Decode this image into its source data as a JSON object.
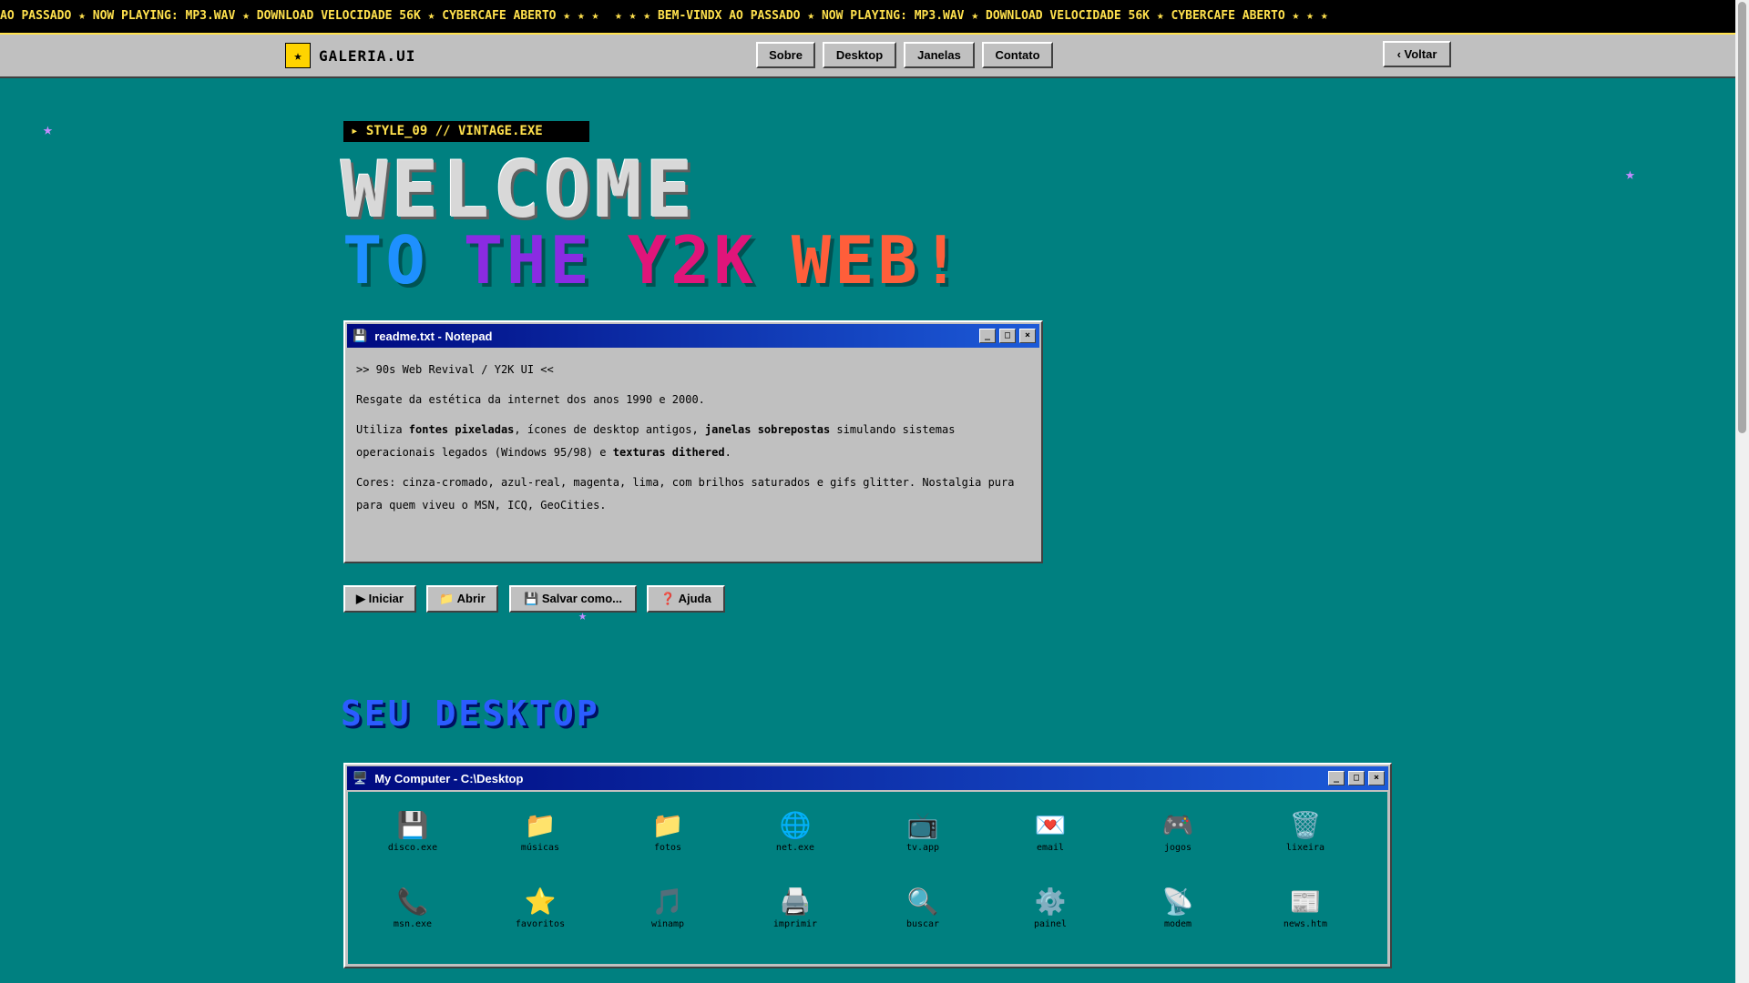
{
  "marquee": {
    "text_left": "AO PASSADO ★ NOW PLAYING: MP3.WAV ★ DOWNLOAD VELOCIDADE 56K ★ CYBERCAFE ABERTO ★ ★ ★",
    "text_right": "★ ★ ★ BEM-VINDX AO PASSADO ★ NOW PLAYING: MP3.WAV ★ DOWNLOAD VELOCIDADE 56K ★ CYBERCAFE ABERTO ★ ★ ★"
  },
  "nav": {
    "brand_icon": "★",
    "brand": "GALERIA.UI",
    "links": [
      "Sobre",
      "Desktop",
      "Janelas",
      "Contato"
    ],
    "back": "‹ Voltar"
  },
  "hero": {
    "tag": "▸ STYLE_09 // VINTAGE.EXE",
    "line1": "WELCOME",
    "line2": [
      {
        "text": "TO",
        "color": "#1e90ff"
      },
      {
        "text": "THE",
        "color": "#8a2be2"
      },
      {
        "text": "Y2K",
        "color": "#e0157a"
      },
      {
        "text": "WEB!",
        "color": "#ff5e3a"
      }
    ]
  },
  "notepad": {
    "icon": "💾",
    "title": "readme.txt - Notepad",
    "controls": [
      "_",
      "□",
      "×"
    ],
    "line1": ">> 90s Web Revival / Y2K UI <<",
    "line2": "Resgate da estética da internet dos anos 1990 e 2000.",
    "p3a": "Utiliza ",
    "p3b": "fontes pixeladas",
    "p3c": ", ícones de desktop antigos, ",
    "p3d": "janelas sobrepostas",
    "p3e": " simulando sistemas operacionais legados (Windows 95/98) e ",
    "p3f": "texturas dithered",
    "p3g": ".",
    "line4": "Cores: cinza-cromado, azul-real, magenta, lima, com brilhos saturados e gifs glitter. Nostalgia pura para quem viveu o MSN, ICQ, GeoCities."
  },
  "actions": [
    "▶ Iniciar",
    "📁 Abrir",
    "💾 Salvar como...",
    "❓ Ajuda"
  ],
  "desktop": {
    "section_title": "SEU DESKTOP",
    "window_icon": "🖥️",
    "window_title": "My Computer - C:\\Desktop",
    "controls": [
      "_",
      "□",
      "×"
    ],
    "icons": [
      {
        "glyph": "💾",
        "label": "disco.exe",
        "icon_name": "floppy-icon"
      },
      {
        "glyph": "📁",
        "label": "músicas",
        "icon_name": "folder-icon"
      },
      {
        "glyph": "📁",
        "label": "fotos",
        "icon_name": "folder-icon"
      },
      {
        "glyph": "🌐",
        "label": "net.exe",
        "icon_name": "globe-icon"
      },
      {
        "glyph": "📺",
        "label": "tv.app",
        "icon_name": "tv-icon"
      },
      {
        "glyph": "💌",
        "label": "email",
        "icon_name": "email-icon"
      },
      {
        "glyph": "🎮",
        "label": "jogos",
        "icon_name": "gamepad-icon"
      },
      {
        "glyph": "🗑️",
        "label": "lixeira",
        "icon_name": "trash-icon"
      },
      {
        "glyph": "📞",
        "label": "msn.exe",
        "icon_name": "phone-icon"
      },
      {
        "glyph": "⭐",
        "label": "favoritos",
        "icon_name": "star-icon"
      },
      {
        "glyph": "🎵",
        "label": "winamp",
        "icon_name": "music-icon"
      },
      {
        "glyph": "🖨️",
        "label": "imprimir",
        "icon_name": "printer-icon"
      },
      {
        "glyph": "🔍",
        "label": "buscar",
        "icon_name": "search-icon"
      },
      {
        "glyph": "⚙️",
        "label": "painel",
        "icon_name": "gear-icon"
      },
      {
        "glyph": "📡",
        "label": "modem",
        "icon_name": "satellite-icon"
      },
      {
        "glyph": "📰",
        "label": "news.htm",
        "icon_name": "newspaper-icon"
      }
    ]
  },
  "decor": {
    "star": "★"
  }
}
